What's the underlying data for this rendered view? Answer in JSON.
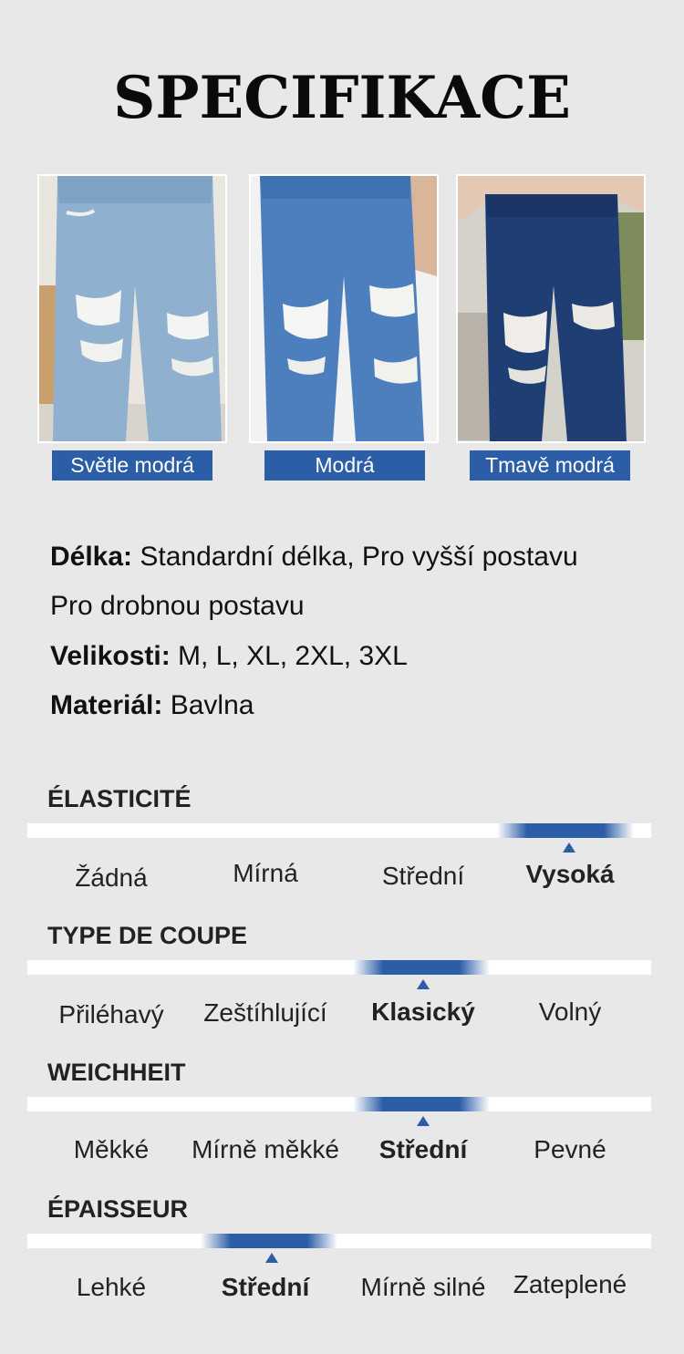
{
  "title": "SPECIFIKACE",
  "colors": {
    "accent": "#2c5ea8",
    "background": "#e8e8e8"
  },
  "variants": [
    {
      "label": "Světle modrá",
      "image": "light-blue-ripped-jeans-photo"
    },
    {
      "label": "Modrá",
      "image": "blue-ripped-jeans-photo"
    },
    {
      "label": "Tmavě modrá",
      "image": "dark-blue-ripped-jeans-photo"
    }
  ],
  "specs": {
    "length_label": "Délka:",
    "length_value": " Standardní délka, Pro vyšší postavu",
    "length_value_cont": "Pro drobnou postavu",
    "sizes_label": "Velikosti:",
    "sizes_value": " M, L, XL, 2XL, 3XL",
    "material_label": "Materiál:",
    "material_value": " Bavlna"
  },
  "scales": [
    {
      "title": "ÉLASTICITÉ",
      "options": [
        "Žádná",
        "Mírná",
        "Střední",
        "Vysoká"
      ],
      "selected_index": 3
    },
    {
      "title": "TYPE DE COUPE",
      "options": [
        "Přiléhavý",
        "Zeštíhlující",
        "Klasický",
        "Volný"
      ],
      "selected_index": 2
    },
    {
      "title": "WEICHHEIT",
      "options": [
        "Měkké",
        "Mírně měkké",
        "Střední",
        "Pevné"
      ],
      "selected_index": 2
    },
    {
      "title": "ÉPAISSEUR",
      "options": [
        "Lehké",
        "Střední",
        "Mírně silné",
        "Zateplené"
      ],
      "selected_index": 1
    }
  ]
}
